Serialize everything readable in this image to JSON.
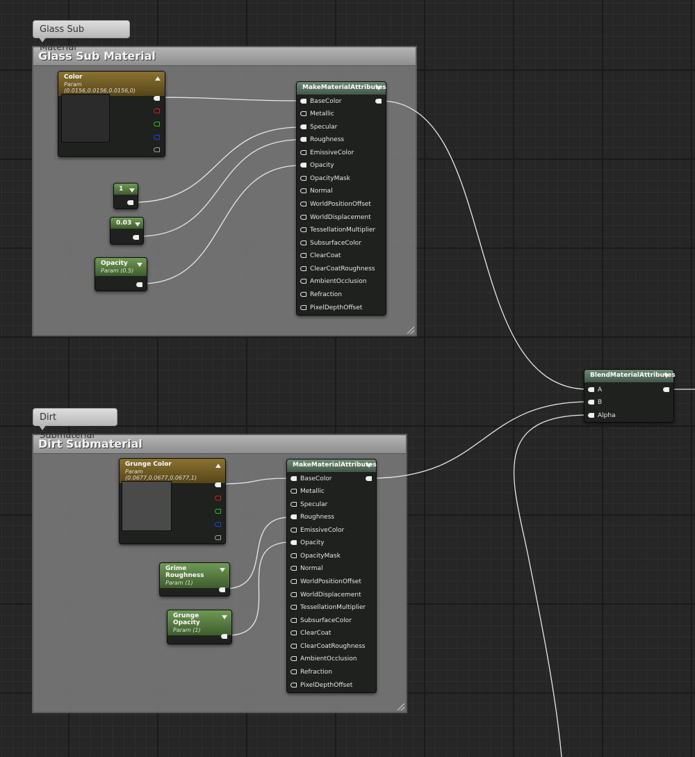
{
  "comments": {
    "glass": {
      "bubble": "Glass Sub Material",
      "title": "Glass Sub Material"
    },
    "dirt": {
      "bubble": "Dirt Submaterial",
      "title": "Dirt Submaterial"
    }
  },
  "glass_nodes": {
    "color": {
      "title": "Color",
      "subtitle": "Param (0.0156,0.0156,0.0156,0)",
      "preview_color": "#2b2b2b"
    },
    "const1": {
      "value": "1"
    },
    "const2": {
      "value": "0.03"
    },
    "opacity": {
      "title": "Opacity",
      "subtitle": "Param (0.5)"
    }
  },
  "dirt_nodes": {
    "color": {
      "title": "Grunge Color",
      "subtitle": "Param (0.0677,0.0677,0.0677,1)",
      "preview_color": "#4a4a4a"
    },
    "roughness": {
      "title": "Grime Roughness",
      "subtitle": "Param (1)"
    },
    "opacity": {
      "title": "Grunge Opacity",
      "subtitle": "Param (1)"
    }
  },
  "make_attributes": {
    "title": "MakeMaterialAttributes",
    "pins": [
      "BaseColor",
      "Metallic",
      "Specular",
      "Roughness",
      "EmissiveColor",
      "Opacity",
      "OpacityMask",
      "Normal",
      "WorldPositionOffset",
      "WorldDisplacement",
      "TessellationMultiplier",
      "SubsurfaceColor",
      "ClearCoat",
      "ClearCoatRoughness",
      "AmbientOcclusion",
      "Refraction",
      "PixelDepthOffset"
    ]
  },
  "blend": {
    "title": "BlendMaterialAttributes",
    "pins": [
      "A",
      "B",
      "Alpha"
    ]
  },
  "colors": {
    "gold_header": "#8a7230",
    "green_header": "#6f9a55",
    "grey_header": "#6e8a73",
    "wire": "#e8e8e8",
    "canvas": "#262626"
  }
}
